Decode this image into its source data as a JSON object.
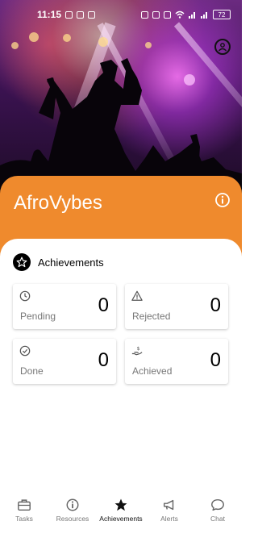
{
  "status_bar": {
    "time": "11:15",
    "battery": "72",
    "left_icons": [
      "whatsapp-icon",
      "linkedin-icon",
      "message-icon"
    ],
    "right_icons": [
      "nfc-icon",
      "alarm-icon",
      "mute-icon",
      "wifi-icon",
      "signal-icon",
      "signal-icon"
    ]
  },
  "header": {
    "brand": "AfroVybes",
    "profile_icon": "user-circle-icon",
    "info_icon": "info-icon",
    "accent_color": "#ef8a2d"
  },
  "achievements": {
    "title": "Achievements",
    "cards": [
      {
        "icon": "clock-icon",
        "label": "Pending",
        "value": "0"
      },
      {
        "icon": "warning-icon",
        "label": "Rejected",
        "value": "0"
      },
      {
        "icon": "check-circle-icon",
        "label": "Done",
        "value": "0"
      },
      {
        "icon": "hand-money-icon",
        "label": "Achieved",
        "value": "0"
      }
    ]
  },
  "bottom_nav": {
    "active": "Achievements",
    "items": [
      {
        "icon": "briefcase-icon",
        "label": "Tasks"
      },
      {
        "icon": "info-icon",
        "label": "Resources"
      },
      {
        "icon": "star-icon",
        "label": "Achievements"
      },
      {
        "icon": "megaphone-icon",
        "label": "Alerts"
      },
      {
        "icon": "chat-icon",
        "label": "Chat"
      }
    ]
  }
}
